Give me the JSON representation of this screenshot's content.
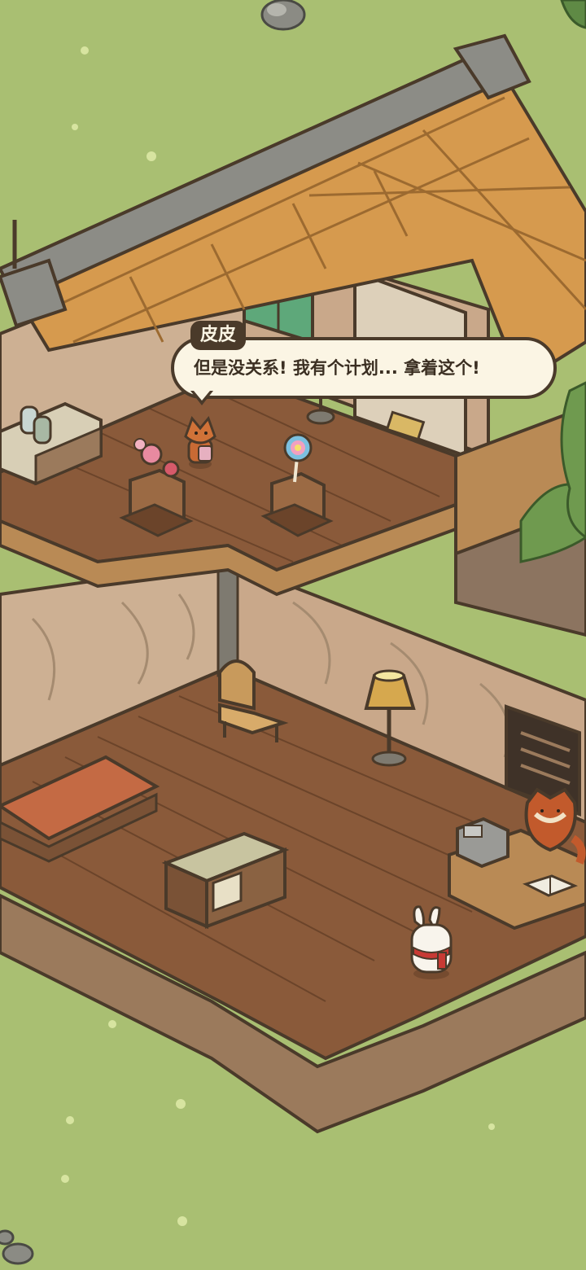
{
  "dialog": {
    "speaker": "皮皮",
    "text": "但是没关系! 我有个计划... 拿着这个!"
  },
  "colors": {
    "grass": "#a9bf72",
    "roof": "#d69a4e",
    "wood_floor": "#8a5a3a",
    "wall": "#cdb093",
    "bubble_bg": "#fbf5e4",
    "bubble_border": "#4a3a2a"
  },
  "scene": {
    "characters": [
      "fox-shopkeeper",
      "rabbit-player",
      "red-panda-reader"
    ],
    "icons": [
      "candy-icon",
      "lollipop-icon",
      "cash-register-icon",
      "book-icon",
      "lamp-icon",
      "chair-icon",
      "bed-icon",
      "cabinet-icon"
    ]
  }
}
